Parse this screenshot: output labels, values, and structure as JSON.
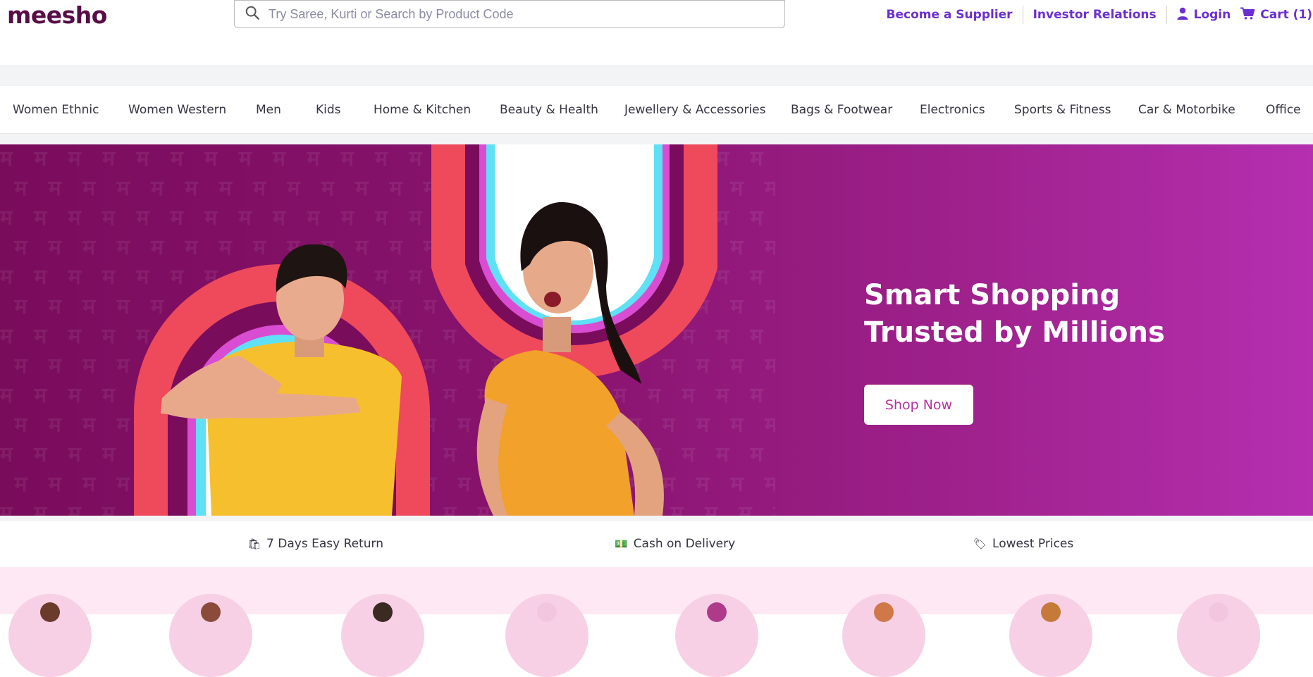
{
  "header": {
    "logo": "meesho",
    "search_placeholder": "Try Saree, Kurti or Search by Product Code",
    "links": {
      "become_supplier": "Become a Supplier",
      "investor_relations": "Investor Relations",
      "login": "Login",
      "cart": "Cart (1)"
    },
    "icons": [
      "search-icon",
      "user-icon",
      "cart-icon"
    ]
  },
  "categories": [
    "Women Ethnic",
    "Women Western",
    "Men",
    "Kids",
    "Home & Kitchen",
    "Beauty & Health",
    "Jewellery & Accessories",
    "Bags & Footwear",
    "Electronics",
    "Sports & Fitness",
    "Car & Motorbike",
    "Office"
  ],
  "banner": {
    "headline_line1": "Smart Shopping",
    "headline_line2": "Trusted by Millions",
    "button": "Shop Now"
  },
  "benefits": [
    {
      "icon": "🛍",
      "label": "7 Days Easy Return"
    },
    {
      "icon": "💵",
      "label": "Cash on Delivery"
    },
    {
      "icon": "🏷",
      "label": "Lowest Prices"
    }
  ],
  "colors": {
    "brand": "#570d48",
    "link": "#6b2fd0",
    "banner_start": "#7a0c5c",
    "banner_end": "#b52fb0",
    "button_text": "#b8329c"
  }
}
